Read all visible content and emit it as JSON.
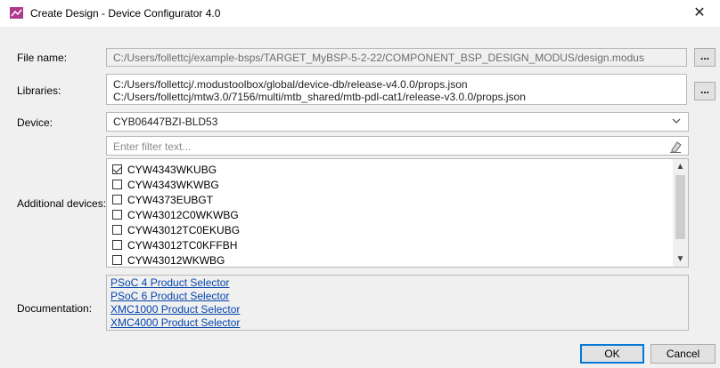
{
  "window": {
    "title": "Create Design - Device Configurator 4.0",
    "close_icon": "✕"
  },
  "form": {
    "file_name_label": "File name:",
    "file_name_value": "C:/Users/follettcj/example-bsps/TARGET_MyBSP-5-2-22/COMPONENT_BSP_DESIGN_MODUS/design.modus",
    "libraries_label": "Libraries:",
    "libraries_values": [
      "C:/Users/follettcj/.modustoolbox/global/device-db/release-v4.0.0/props.json",
      "C:/Users/follettcj/mtw3.0/7156/multi/mtb_shared/mtb-pdl-cat1/release-v3.0.0/props.json"
    ],
    "browse_label": "...",
    "device_label": "Device:",
    "device_value": "CYB06447BZI-BLD53",
    "filter_placeholder": "Enter filter text...",
    "additional_devices_label": "Additional devices:",
    "additional_devices": [
      {
        "label": "CYW4343WKUBG",
        "checked": true
      },
      {
        "label": "CYW4343WKWBG",
        "checked": false
      },
      {
        "label": "CYW4373EUBGT",
        "checked": false
      },
      {
        "label": "CYW43012C0WKWBG",
        "checked": false
      },
      {
        "label": "CYW43012TC0EKUBG",
        "checked": false
      },
      {
        "label": "CYW43012TC0KFFBH",
        "checked": false
      },
      {
        "label": "CYW43012WKWBG",
        "checked": false
      }
    ],
    "documentation_label": "Documentation:",
    "documentation_links": [
      "PSoC 4 Product Selector",
      "PSoC 6 Product Selector",
      "XMC1000 Product Selector",
      "XMC4000 Product Selector"
    ]
  },
  "buttons": {
    "ok": "OK",
    "cancel": "Cancel"
  },
  "icons": {
    "app": "device-configurator-icon",
    "eraser": "eraser-icon",
    "dropdown": "chevron-down-icon"
  },
  "colors": {
    "link": "#0645ad",
    "app_icon": "#b03a8a",
    "focus": "#0078d7"
  }
}
